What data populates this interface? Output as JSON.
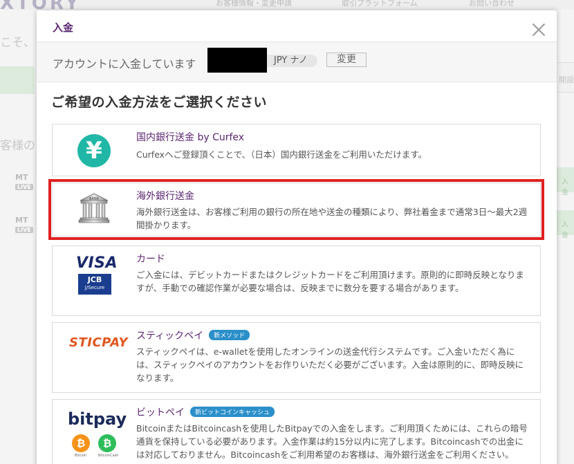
{
  "background": {
    "logo": "XTORY",
    "nav": [
      "お客様情報・変更申請",
      "取引プラットフォーム",
      "お問い合わせ"
    ],
    "left_texts": [
      "こそ、",
      "客様の"
    ],
    "mt4_label": "MT",
    "live_label": "LIVE",
    "right_texts": [
      "開設",
      "入金",
      "入金"
    ]
  },
  "modal": {
    "title": "入金",
    "account_text": "アカウントに入金しています",
    "currency": "JPY ナノ",
    "change_label": "変更",
    "heading": "ご希望の入金方法をご選択ください"
  },
  "methods": [
    {
      "name": "国内銀行送金 by Curfex",
      "description": "Curfexへご登録頂くことで、（日本）国内銀行送金をご利用いただけます。",
      "icon": "yen-icon",
      "icon_text": "¥"
    },
    {
      "name": "海外銀行送金",
      "description": "海外銀行送金は、お客様ご利用の銀行の所在地や送金の種類により、弊社着金まで通常3日～最大2週間掛かります。",
      "icon": "bank-icon",
      "icon_text": "BANK",
      "selected": true
    },
    {
      "name": "カード",
      "description": "ご入金には、デビットカードまたはクレジットカードをご利用頂けます。原則的に即時反映となりますが、手動での確認作業が必要な場合は、反映までに数分を要する場合があります。",
      "icon": "card-icon",
      "visa_text": "VISA",
      "jcb_text": "JCB",
      "jcb_sub": "J/Secure"
    },
    {
      "name": "スティックペイ",
      "badge": "新メソッド",
      "description": "スティックペイは、e-walletを使用したオンラインの送金代行システムです。ご入金いただく為には、スティックペイのアカウントをお作りいただく必要がございます。入金は原則的に、即時反映になります。",
      "icon": "sticpay-icon",
      "icon_text": "STICPAY"
    },
    {
      "name": "ビットペイ",
      "badge": "新ビットコインキャッシュ",
      "description": "BitcoinまたはBitcoincashを使用したBitpayでの入金をします。ご利用頂くためには、これらの暗号通貨を保持している必要があります。入金作業は約15分以内に完了します。Bitcoincashでの出金には対応しておりません。Bitcoincashをご利用希望のお客様は、海外銀行送金をご利用ください。",
      "icon": "bitpay-icon",
      "icon_text": "bitpay",
      "coin1": "Bitcoin",
      "coin2": "BitcoinCash"
    }
  ],
  "colors": {
    "accent": "#5b2670",
    "highlight": "#e02020",
    "badge": "#2b8fc9"
  }
}
